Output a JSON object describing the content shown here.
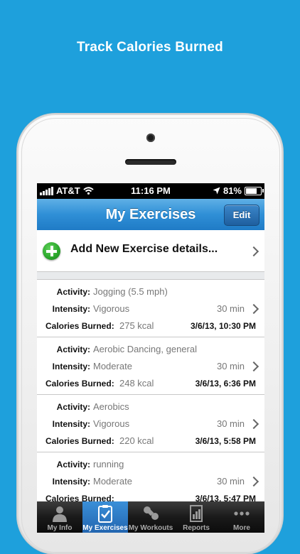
{
  "promo_title": "Track Calories Burned",
  "status_bar": {
    "carrier": "AT&T",
    "time": "11:16 PM",
    "battery": "81%",
    "battery_fraction": 0.81
  },
  "nav": {
    "title": "My Exercises",
    "edit_label": "Edit"
  },
  "add_row": {
    "label": "Add New Exercise details..."
  },
  "labels": {
    "activity": "Activity:",
    "intensity": "Intensity:",
    "calories": "Calories Burned:"
  },
  "exercises": [
    {
      "activity": "Jogging (5.5 mph)",
      "intensity": "Vigorous",
      "duration": "30 min",
      "calories": "275 kcal",
      "timestamp": "3/6/13, 10:30 PM"
    },
    {
      "activity": "Aerobic Dancing, general",
      "intensity": "Moderate",
      "duration": "30 min",
      "calories": "248 kcal",
      "timestamp": "3/6/13, 6:36 PM"
    },
    {
      "activity": "Aerobics",
      "intensity": "Vigorous",
      "duration": "30 min",
      "calories": "220 kcal",
      "timestamp": "3/6/13, 5:58 PM"
    },
    {
      "activity": "running",
      "intensity": "Moderate",
      "duration": "30 min",
      "calories": "",
      "timestamp": "3/6/13, 5:47 PM"
    }
  ],
  "tabs": [
    {
      "label": "My Info",
      "icon": "person-icon",
      "active": false
    },
    {
      "label": "My Exercises",
      "icon": "clipboard-icon",
      "active": true
    },
    {
      "label": "My Workouts",
      "icon": "molecule-icon",
      "active": false
    },
    {
      "label": "Reports",
      "icon": "report-icon",
      "active": false
    },
    {
      "label": "More",
      "icon": "more-dots-icon",
      "active": false
    }
  ],
  "colors": {
    "background": "#1ea0dc",
    "nav_blue": "#2f8fd6",
    "add_green": "#2aa52b"
  }
}
